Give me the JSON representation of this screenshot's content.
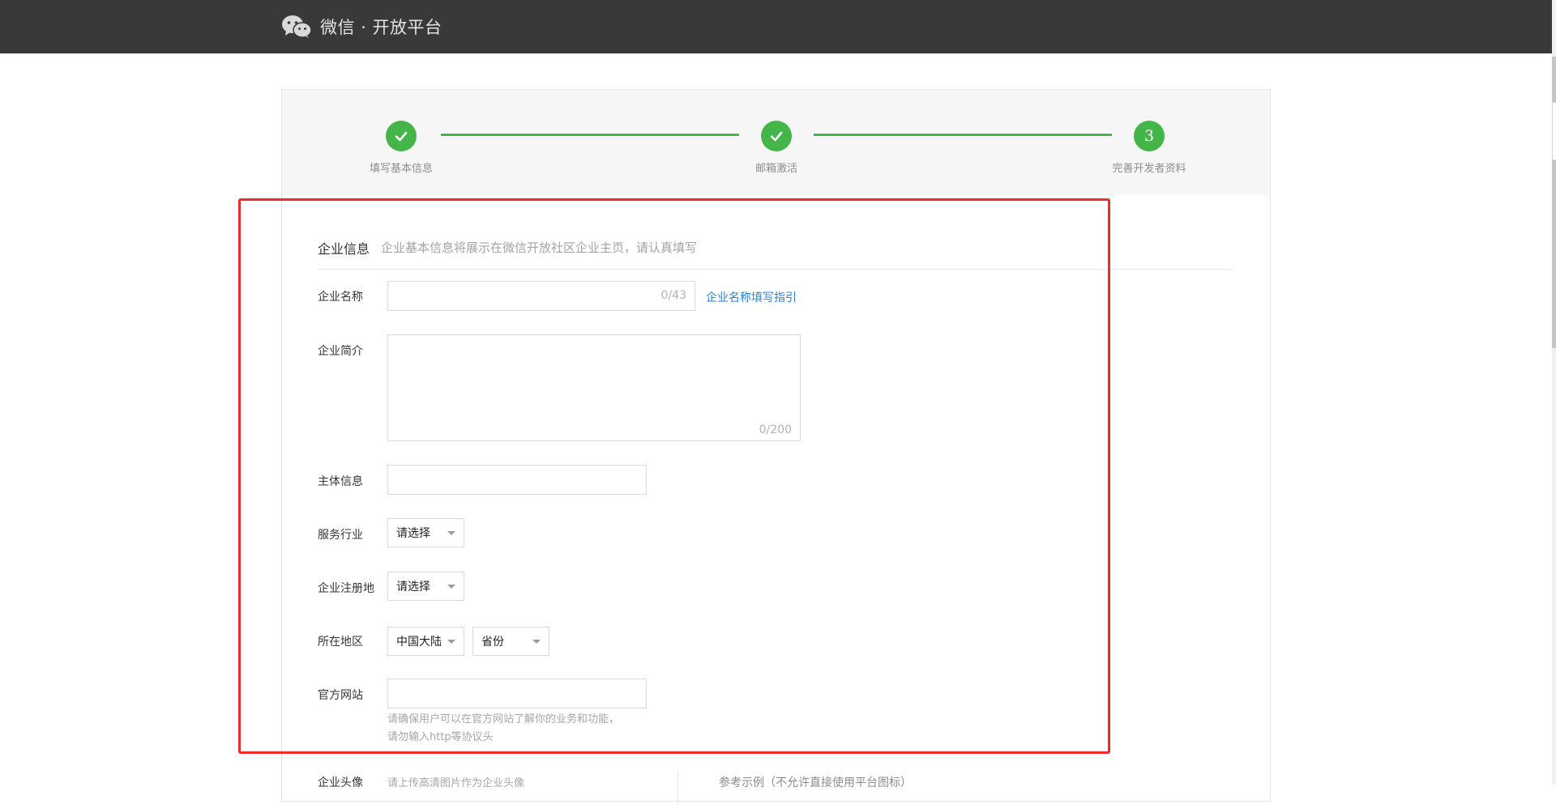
{
  "header": {
    "brand_title": "微信 · 开放平台",
    "brand_icon": "wechat-logo-icon"
  },
  "steps": [
    {
      "label": "填写基本信息",
      "state": "done",
      "icon": "check-icon"
    },
    {
      "label": "邮箱激活",
      "state": "done",
      "icon": "check-icon"
    },
    {
      "label": "完善开发者资料",
      "state": "current",
      "number": "3"
    }
  ],
  "section": {
    "title": "企业信息",
    "description": "企业基本信息将展示在微信开放社区企业主页，请认真填写"
  },
  "form": {
    "company_name": {
      "label": "企业名称",
      "value": "",
      "counter": "0/43",
      "guide_link": "企业名称填写指引"
    },
    "company_intro": {
      "label": "企业简介",
      "value": "",
      "counter": "0/200"
    },
    "entity_info": {
      "label": "主体信息",
      "value": ""
    },
    "industry": {
      "label": "服务行业",
      "selected": "请选择"
    },
    "registration": {
      "label": "企业注册地",
      "selected": "请选择"
    },
    "region": {
      "label": "所在地区",
      "country": "中国大陆",
      "province": "省份"
    },
    "website": {
      "label": "官方网站",
      "value": "",
      "hint_line1": "请确保用户可以在官方网站了解你的业务和功能，",
      "hint_line2": "请勿输入http等协议头"
    },
    "avatar": {
      "label": "企业头像",
      "hint": "请上传高清图片作为企业头像",
      "example_label": "参考示例（不允许直接使用平台图标）"
    }
  },
  "colors": {
    "topbar": "#393939",
    "accent_green": "#44b549",
    "link_blue": "#2b84e0",
    "highlight_red": "#ee2a2a"
  }
}
